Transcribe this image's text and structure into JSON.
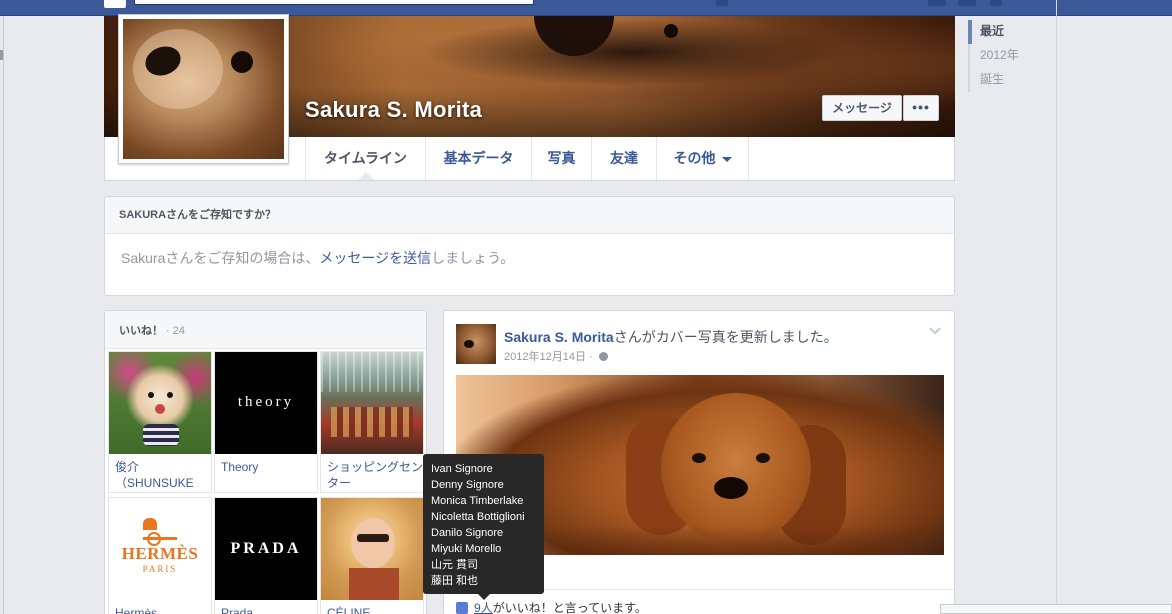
{
  "profile": {
    "name": "Sakura S. Morita",
    "message_button": "メッセージ",
    "more_button": "•••"
  },
  "nav": {
    "tabs": [
      {
        "label": "タイムライン"
      },
      {
        "label": "基本データ"
      },
      {
        "label": "写真"
      },
      {
        "label": "友達"
      },
      {
        "label": "その他"
      }
    ]
  },
  "year_nav": [
    "最近",
    "2012年",
    "誕生"
  ],
  "know_box": {
    "title": "SAKURAさんをご存知ですか？",
    "text_before": "Sakuraさんをご存知の場合は、",
    "link": "メッセージを送信",
    "text_after": "しましょう。"
  },
  "likes": {
    "title": "いいね！",
    "separator": "·",
    "count": "24",
    "items": [
      {
        "name": "俊介\n（SHUNSUKE",
        "icon": "pomeranian-photo"
      },
      {
        "name": "Theory",
        "icon": "theory-logo",
        "logo_text": "theory"
      },
      {
        "name": "ショッピングセンター",
        "icon": "mall-photo"
      },
      {
        "name": "Hermès",
        "icon": "hermes-logo",
        "logo_text": "HERMÈS",
        "logo_sub": "PARIS"
      },
      {
        "name": "Prada",
        "icon": "prada-logo",
        "logo_text": "PRADA"
      },
      {
        "name": "CÉLINE",
        "icon": "celine-photo"
      }
    ]
  },
  "post": {
    "author": "Sakura S. Morita",
    "action": "さんがカバー写真を更新しました。",
    "date": "2012年12月14日",
    "meta_sep": " · ",
    "likes_link": "9人",
    "likes_text": "がいいね！と言っています。"
  },
  "tooltip": {
    "names": [
      "Ivan Signore",
      "Denny Signore",
      "Monica Timberlake",
      "Nicoletta Bottiglioni",
      "Danilo Signore",
      "Miyuki Morello",
      "山元 貫司",
      "藤田 和也"
    ]
  },
  "colors": {
    "brand_blue": "#3b5998",
    "hermes_orange": "#e8761c",
    "page_bg": "#e9eaed"
  }
}
